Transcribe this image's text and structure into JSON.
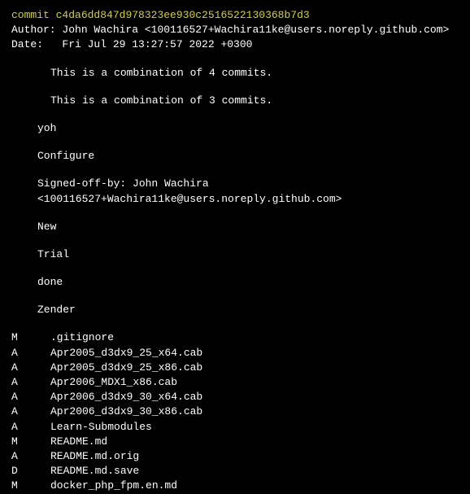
{
  "commit": {
    "label": "commit",
    "hash": "c4da6dd847d978323ee930c2516522130368b7d3"
  },
  "author": {
    "label": "Author:",
    "value": "John Wachira <100116527+Wachira11ke@users.noreply.github.com>"
  },
  "date": {
    "label": "Date:",
    "value": "Fri Jul 29 13:27:57 2022 +0300"
  },
  "messages": {
    "combo4": "This is a combination of 4 commits.",
    "combo3": "This is a combination of 3 commits.",
    "yoh": "yoh",
    "configure": "Configure",
    "signed": "Signed-off-by: John Wachira <100116527+Wachira11ke@users.noreply.github.com>",
    "new": "New",
    "trial": "Trial",
    "done": "done",
    "zender": "Zender"
  },
  "files": [
    {
      "status": "M",
      "name": ".gitignore"
    },
    {
      "status": "A",
      "name": "Apr2005_d3dx9_25_x64.cab"
    },
    {
      "status": "A",
      "name": "Apr2005_d3dx9_25_x86.cab"
    },
    {
      "status": "A",
      "name": "Apr2006_MDX1_x86.cab"
    },
    {
      "status": "A",
      "name": "Apr2006_d3dx9_30_x64.cab"
    },
    {
      "status": "A",
      "name": "Apr2006_d3dx9_30_x86.cab"
    },
    {
      "status": "A",
      "name": "Learn-Submodules"
    },
    {
      "status": "M",
      "name": "README.md"
    },
    {
      "status": "A",
      "name": "README.md.orig"
    },
    {
      "status": "D",
      "name": "README.md.save"
    },
    {
      "status": "M",
      "name": "docker_php_fpm.en.md"
    }
  ]
}
